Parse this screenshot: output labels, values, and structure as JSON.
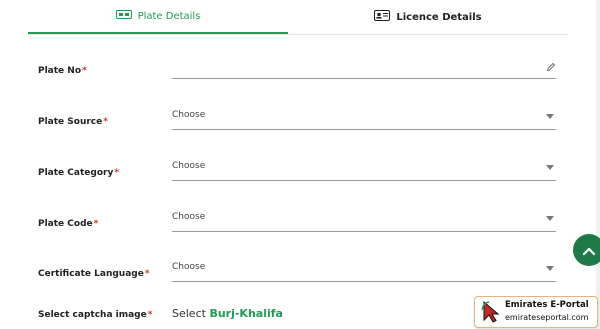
{
  "tabs": [
    {
      "label": "Plate Details",
      "icon": "plate-icon"
    },
    {
      "label": "Licence Details",
      "icon": "id-card-icon"
    }
  ],
  "form": {
    "plate_no": {
      "label": "Plate No",
      "required": "*"
    },
    "plate_source": {
      "label": "Plate Source",
      "required": "*",
      "value": "Choose"
    },
    "plate_category": {
      "label": "Plate Category",
      "required": "*",
      "value": "Choose"
    },
    "plate_code": {
      "label": "Plate Code",
      "required": "*",
      "value": "Choose"
    },
    "certificate_language": {
      "label": "Certificate Language",
      "required": "*",
      "value": "Choose"
    },
    "captcha": {
      "label": "Select captcha image",
      "required": "*",
      "prefix": "Select",
      "target": "Burj-Khalifa"
    }
  },
  "watermark": {
    "title": "Emirates E-Portal",
    "url": "emirateseportal.com"
  },
  "colors": {
    "accent": "#1f9d55",
    "required": "#d93025",
    "fab": "#1f7a4a"
  }
}
